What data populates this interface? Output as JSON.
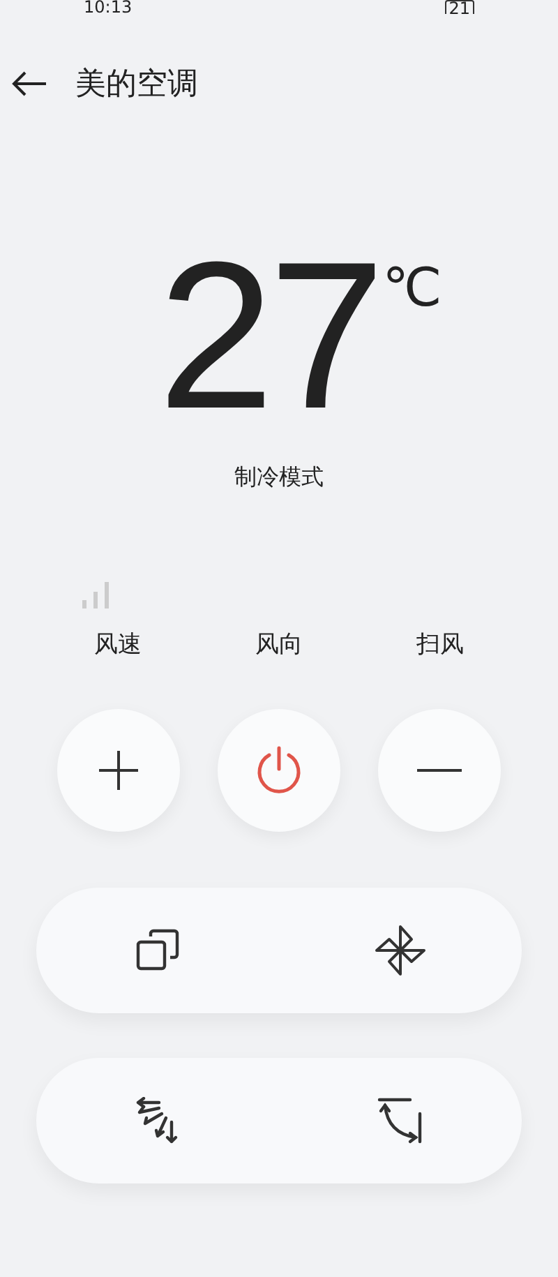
{
  "status_bar": {
    "time": "10:13",
    "battery": "21"
  },
  "header": {
    "title": "美的空调"
  },
  "temperature": {
    "value": "27",
    "unit": "℃"
  },
  "mode": "制冷模式",
  "controls": [
    {
      "label": "风速"
    },
    {
      "label": "风向"
    },
    {
      "label": "扫风"
    }
  ],
  "round_buttons": [
    {
      "kind": "plus"
    },
    {
      "kind": "power"
    },
    {
      "kind": "minus"
    }
  ],
  "pill_rows": [
    {
      "buttons": [
        {
          "kind": "copy"
        },
        {
          "kind": "pinwheel"
        }
      ]
    },
    {
      "buttons": [
        {
          "kind": "fan-spread"
        },
        {
          "kind": "corner-rotate"
        }
      ]
    }
  ]
}
